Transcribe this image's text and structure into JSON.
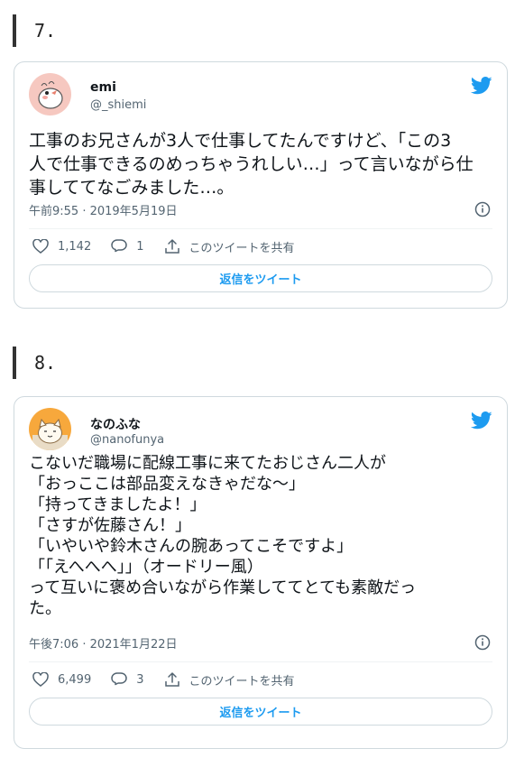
{
  "sections": [
    {
      "number": "7.",
      "tweet": {
        "display_name": "emi",
        "handle": "@_shiemi",
        "body_lines": [
          "工事のお兄さんが3人で仕事してたんですけど、「この3",
          "人で仕事できるのめっちゃうれしい…」って言いながら仕",
          "事しててなごみました…。"
        ],
        "timestamp": "午前9:55 · 2019年5月19日",
        "likes": "1,142",
        "replies": "1",
        "share_label": "このツイートを共有",
        "reply_button": "返信をツイート"
      }
    },
    {
      "number": "8.",
      "tweet": {
        "display_name": "なのふな",
        "handle": "@nanofunya",
        "body_lines": [
          "こないだ職場に配線工事に来てたおじさん二人が",
          "「おっここは部品変えなきゃだな～」",
          "「持ってきましたよ！」",
          "「さすが佐藤さん！」",
          "「いやいや鈴木さんの腕あってこそですよ」",
          "「「えへへへ」」（オードリー風）",
          "って互いに褒め合いながら作業しててとても素敵だっ",
          "た。"
        ],
        "timestamp": "午後7:06 · 2021年1月22日",
        "likes": "6,499",
        "replies": "3",
        "share_label": "このツイートを共有",
        "reply_button": "返信をツイート"
      }
    }
  ],
  "colors": {
    "accent": "#1d9bf0",
    "border": "#cfd9de",
    "muted": "#536471",
    "text": "#0f1419"
  }
}
